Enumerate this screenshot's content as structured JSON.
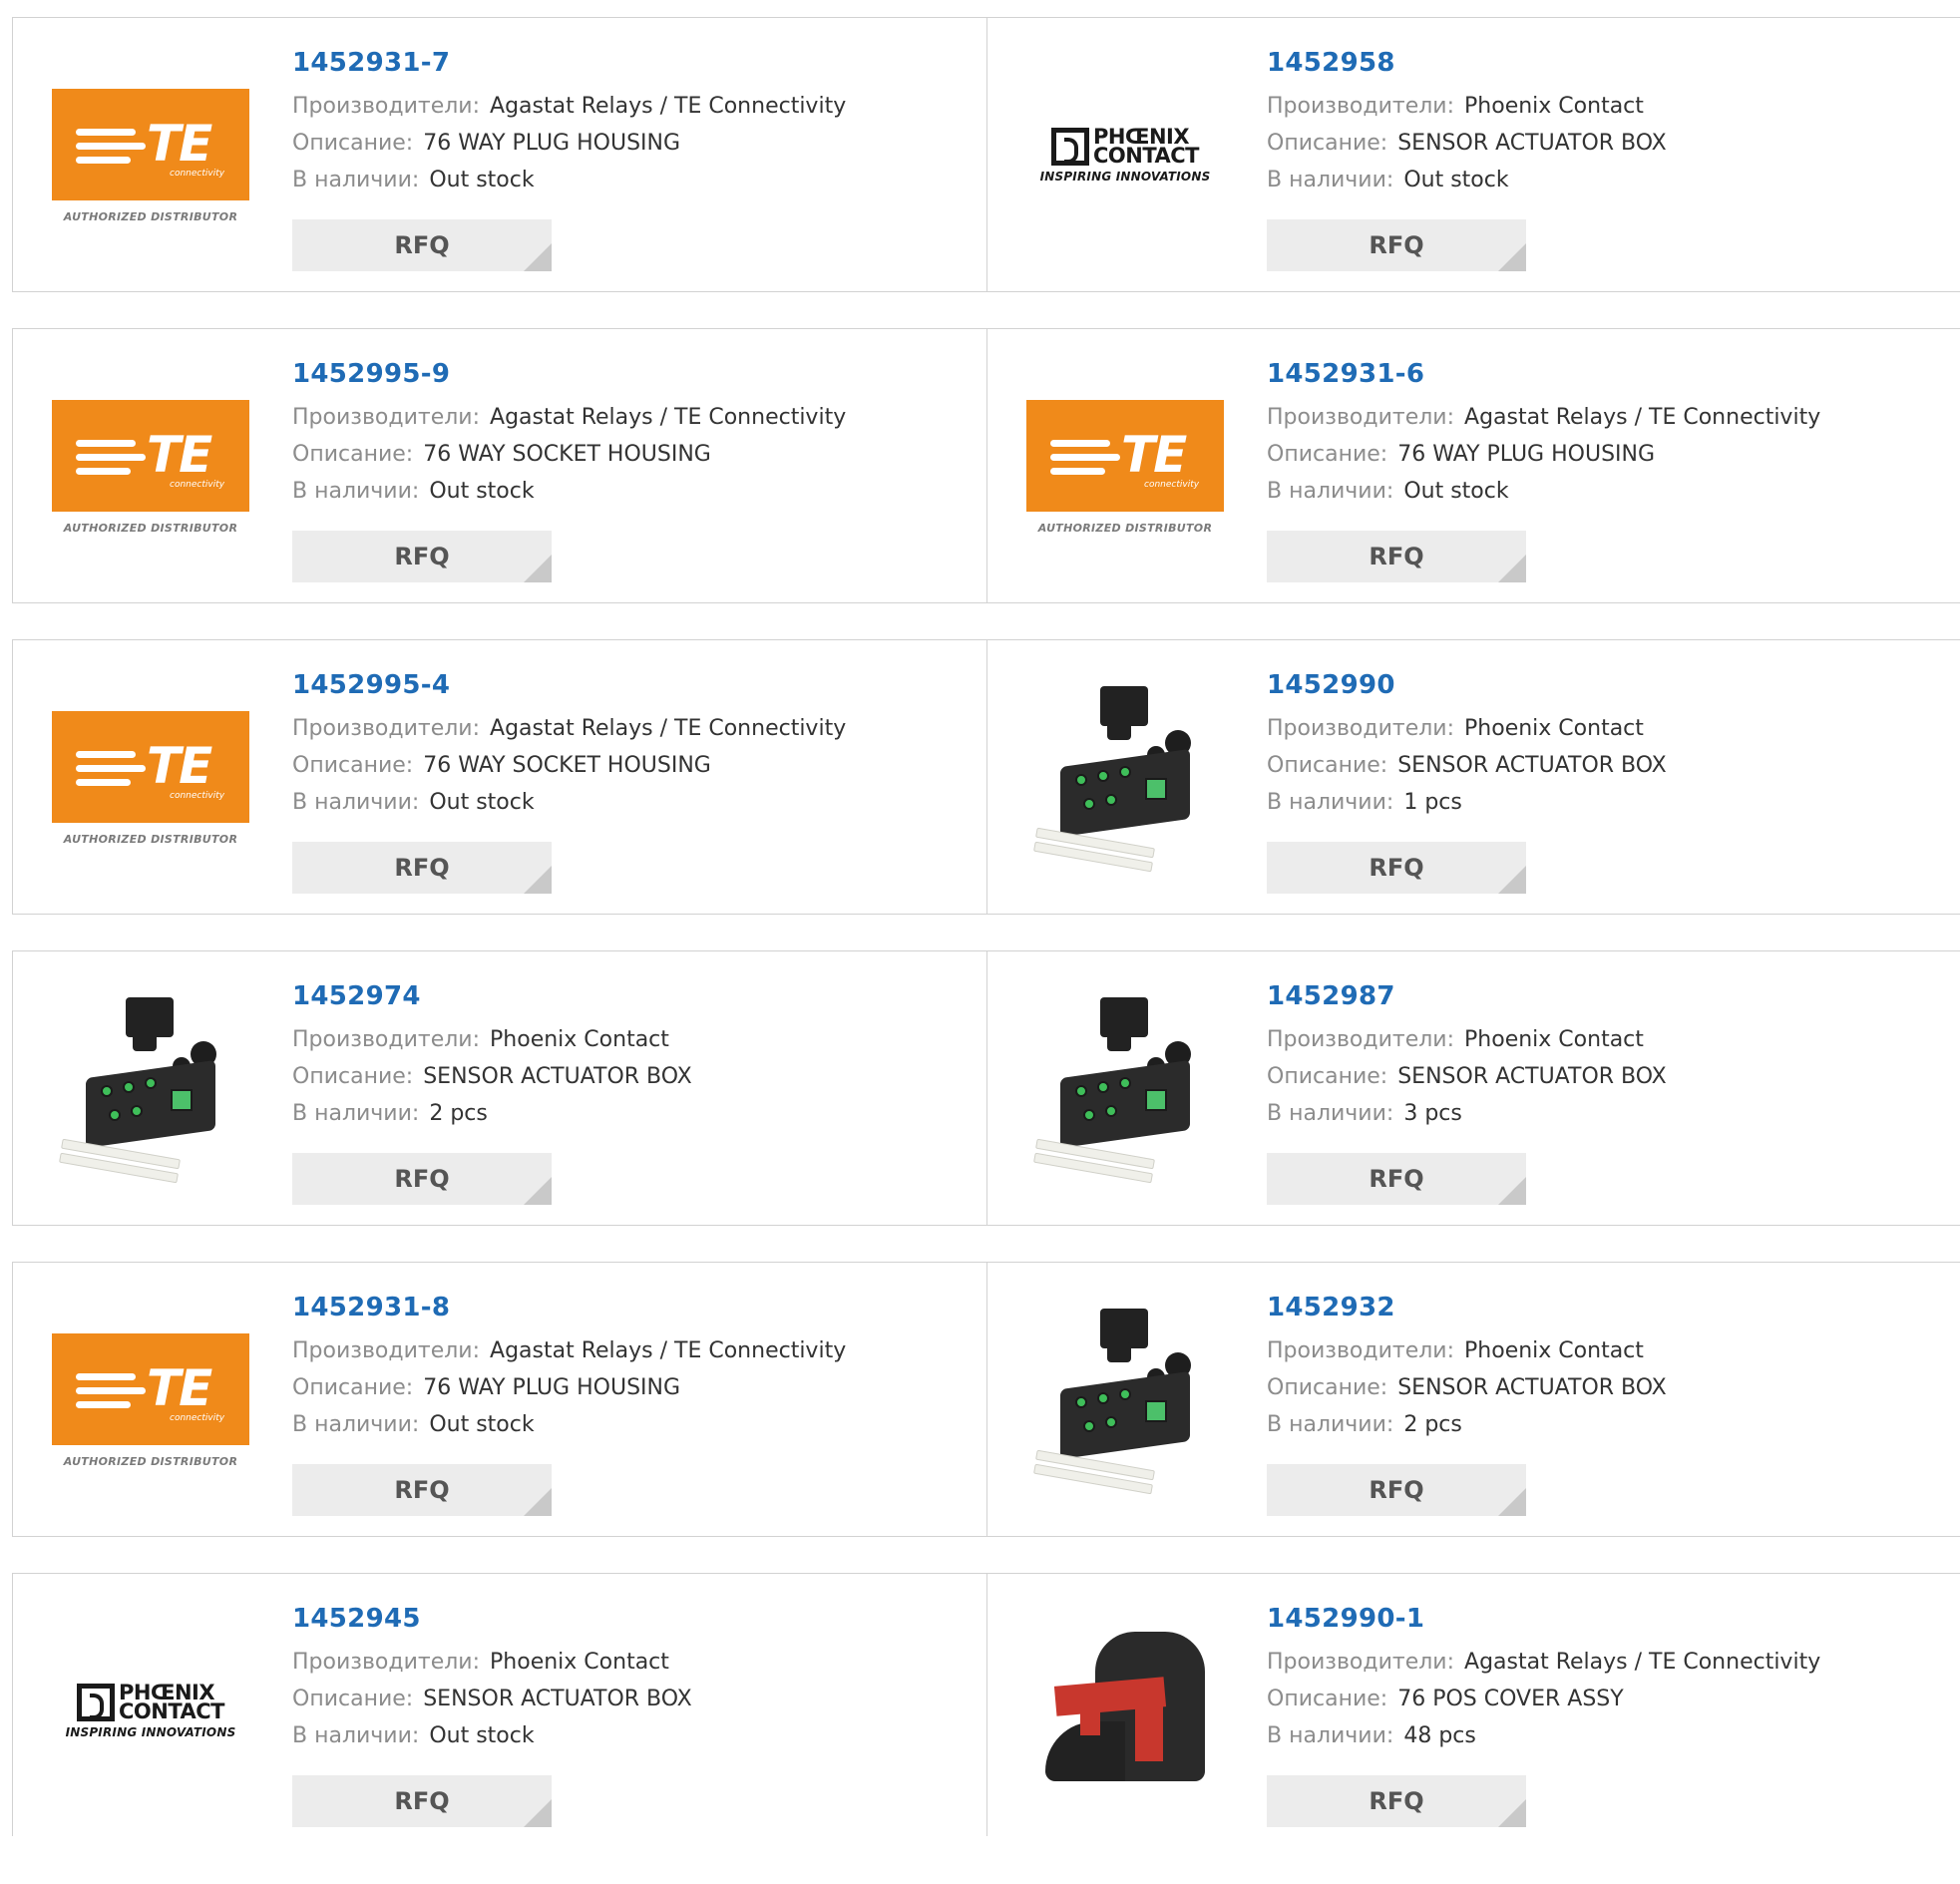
{
  "labels": {
    "manufacturer": "Производители:",
    "description": "Описание:",
    "stock": "В наличии:",
    "rfq": "RFQ"
  },
  "logos": {
    "te_text": "TE",
    "te_sub": "connectivity",
    "te_authorized": "AUTHORIZED DISTRIBUTOR",
    "phoenix_line1": "PHŒNIX",
    "phoenix_line2": "CONTACT",
    "phoenix_tagline": "INSPIRING INNOVATIONS"
  },
  "colors": {
    "part_link": "#1f6bb5",
    "te_orange": "#f08a1a",
    "button_bg": "#ececec"
  },
  "products": [
    {
      "part": "1452931-7",
      "manufacturer": "Agastat Relays / TE Connectivity",
      "description": "76 WAY PLUG HOUSING",
      "stock": "Out stock",
      "image": "te-logo"
    },
    {
      "part": "1452958",
      "manufacturer": "Phoenix Contact",
      "description": "SENSOR ACTUATOR BOX",
      "stock": "Out stock",
      "image": "phoenix-logo"
    },
    {
      "part": "1452995-9",
      "manufacturer": "Agastat Relays / TE Connectivity",
      "description": "76 WAY SOCKET HOUSING",
      "stock": "Out stock",
      "image": "te-logo"
    },
    {
      "part": "1452931-6",
      "manufacturer": "Agastat Relays / TE Connectivity",
      "description": "76 WAY PLUG HOUSING",
      "stock": "Out stock",
      "image": "te-logo"
    },
    {
      "part": "1452995-4",
      "manufacturer": "Agastat Relays / TE Connectivity",
      "description": "76 WAY SOCKET HOUSING",
      "stock": "Out stock",
      "image": "te-logo"
    },
    {
      "part": "1452990",
      "manufacturer": "Phoenix Contact",
      "description": "SENSOR ACTUATOR BOX",
      "stock": "1 pcs",
      "image": "sensor-box-photo"
    },
    {
      "part": "1452974",
      "manufacturer": "Phoenix Contact",
      "description": "SENSOR ACTUATOR BOX",
      "stock": "2 pcs",
      "image": "sensor-box-photo"
    },
    {
      "part": "1452987",
      "manufacturer": "Phoenix Contact",
      "description": "SENSOR ACTUATOR BOX",
      "stock": "3 pcs",
      "image": "sensor-box-photo"
    },
    {
      "part": "1452931-8",
      "manufacturer": "Agastat Relays / TE Connectivity",
      "description": "76 WAY PLUG HOUSING",
      "stock": "Out stock",
      "image": "te-logo"
    },
    {
      "part": "1452932",
      "manufacturer": "Phoenix Contact",
      "description": "SENSOR ACTUATOR BOX",
      "stock": "2 pcs",
      "image": "sensor-box-photo"
    },
    {
      "part": "1452945",
      "manufacturer": "Phoenix Contact",
      "description": "SENSOR ACTUATOR BOX",
      "stock": "Out stock",
      "image": "phoenix-logo"
    },
    {
      "part": "1452990-1",
      "manufacturer": "Agastat Relays / TE Connectivity",
      "description": "76 POS COVER ASSY",
      "stock": "48 pcs",
      "image": "cover-assy-photo"
    }
  ]
}
